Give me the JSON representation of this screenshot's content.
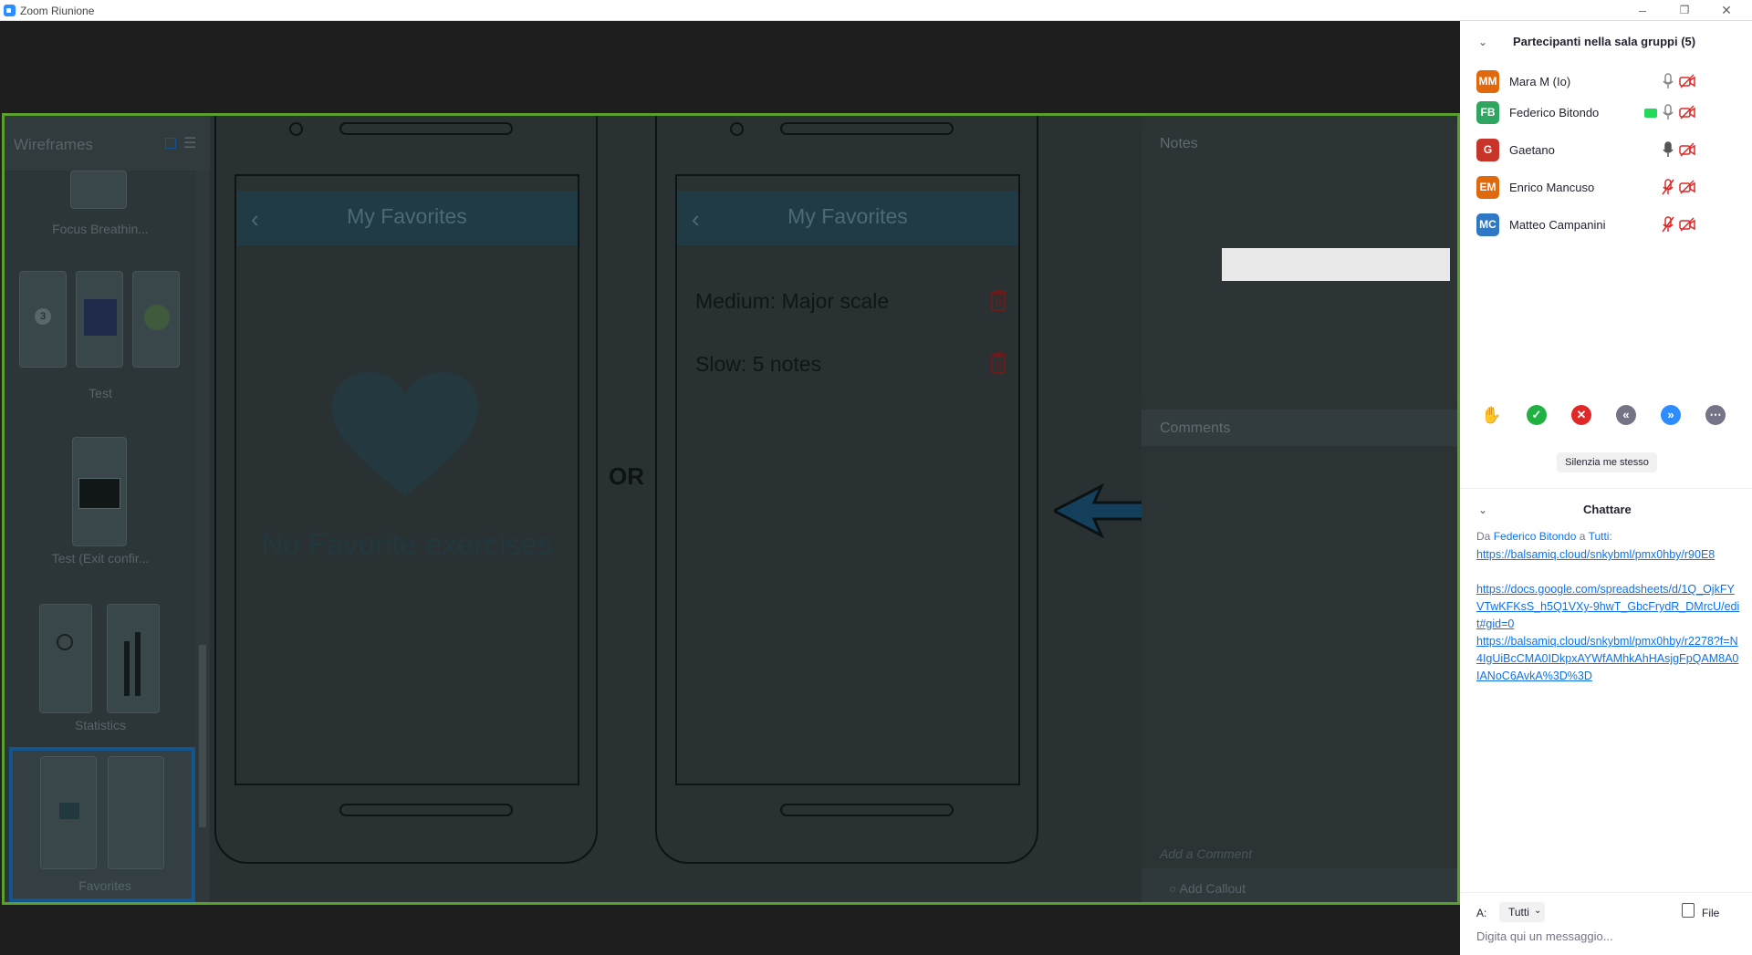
{
  "window": {
    "title": "Zoom Riunione"
  },
  "share": {
    "left_panel": {
      "title": "Wireframes",
      "items": [
        "Focus Breathin...",
        "Test",
        "Test (Exit confir...",
        "Statistics",
        "Favorites"
      ],
      "thumb_number": "3"
    },
    "phone1": {
      "app_title": "My Favorites",
      "empty_text": "No Favorite exercises"
    },
    "or_text": "OR",
    "phone2": {
      "app_title": "My Favorites",
      "items": [
        "Medium: Major scale",
        "Slow: 5 notes"
      ]
    },
    "notes": {
      "title": "Notes",
      "comments_title": "Comments",
      "comment_placeholder": "Add a Comment",
      "callout": "Add Callout"
    }
  },
  "participants": {
    "title": "Partecipanti nella sala gruppi (5)",
    "list": [
      {
        "initials": "MM",
        "name": "Mara M (Io)",
        "color": "#e1690d"
      },
      {
        "initials": "FB",
        "name": "Federico Bitondo",
        "color": "#2fa660"
      },
      {
        "initials": "G",
        "name": "Gaetano",
        "color": "#c7342a"
      },
      {
        "initials": "EM",
        "name": "Enrico Mancuso",
        "color": "#e1690d"
      },
      {
        "initials": "MC",
        "name": "Matteo Campanini",
        "color": "#2f79c4"
      }
    ],
    "mute_me": "Silenzia me stesso"
  },
  "chat": {
    "title": "Chattare",
    "from_prefix": "Da",
    "from_sender": "Federico Bitondo",
    "to_word": "a",
    "to_target": "Tutti",
    "links": [
      "https://balsamiq.cloud/snkybml/pmx0hby/r90E8",
      "https://docs.google.com/spreadsheets/d/1Q_OjkFYVTwKFKsS_h5Q1VXy-9hwT_GbcFrydR_DMrcU/edit#gid=0",
      "https://balsamiq.cloud/snkybml/pmx0hby/r2278?f=N4IgUiBcCMA0IDkpxAYWfAMhkAhHAsjgFpQAM8A0IANoC6AvkA%3D%3D"
    ],
    "to_label": "A:",
    "to_value": "Tutti",
    "file_label": "File",
    "placeholder": "Digita qui un messaggio..."
  }
}
